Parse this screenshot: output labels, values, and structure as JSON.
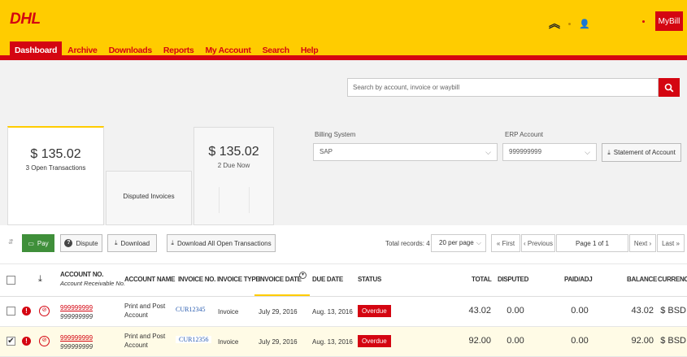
{
  "header": {
    "logo_text": "DHL",
    "mybill_label": "MyBill"
  },
  "nav": {
    "items": [
      "Dashboard",
      "Archive",
      "Downloads",
      "Reports",
      "My Account",
      "Search",
      "Help"
    ]
  },
  "search": {
    "placeholder": "Search by account, invoice or waybill"
  },
  "summary": {
    "open_amount": "$ 135.02",
    "open_label": "3 Open Transactions",
    "disputed_label": "Disputed Invoices",
    "due_amount": "$ 135.02",
    "due_label": "2 Due Now"
  },
  "filters": {
    "billing_label": "Billing System",
    "billing_value": "SAP",
    "erp_label": "ERP Account",
    "erp_value": "999999999",
    "statement_label": "Statement of Account"
  },
  "toolbar": {
    "pay": "Pay",
    "dispute": "Dispute",
    "download": "Download",
    "download_all": "Download All Open Transactions",
    "total_records": "Total records: 4",
    "per_page": "20 per page",
    "first": "« First",
    "previous": "‹ Previous",
    "page_info": "Page 1 of 1",
    "next": "Next ›",
    "last": "Last »"
  },
  "table": {
    "headers": {
      "account_no": "ACCOUNT NO.",
      "account_sub": "Account Receivable No.",
      "account_name": "ACCOUNT NAME",
      "invoice_no": "INVOICE NO.",
      "invoice_type": "INVOICE TYPE",
      "invoice_date": "INVOICE DATE",
      "due_date": "DUE DATE",
      "status": "STATUS",
      "total": "TOTAL",
      "disputed": "DISPUTED",
      "paid_adj": "PAID/ADJ",
      "balance": "BALANCE",
      "currency": "CURRENCY"
    },
    "rows": [
      {
        "account_no": "999999999",
        "ar_no": "999999999",
        "name_l1": "Print and Post",
        "name_l2": "Account",
        "invoice_no": "CUR12345",
        "type": "Invoice",
        "invoice_date": "July 29, 2016",
        "due_date": "Aug. 13, 2016",
        "status": "Overdue",
        "total": "43.02",
        "disputed": "0.00",
        "paid": "0.00",
        "balance": "43.02",
        "currency": "$ BSD",
        "selected": false
      },
      {
        "account_no": "999999999",
        "ar_no": "999999999",
        "name_l1": "Print and Post",
        "name_l2": "Account",
        "invoice_no": "CUR12356",
        "type": "Invoice",
        "invoice_date": "July 29, 2016",
        "due_date": "Aug. 13, 2016",
        "status": "Overdue",
        "total": "92.00",
        "disputed": "0.00",
        "paid": "0.00",
        "balance": "92.00",
        "currency": "$ BSD",
        "selected": true
      }
    ]
  },
  "colors": {
    "brand_yellow": "#ffcc00",
    "brand_red": "#d40511",
    "pay_green": "#3f8f3a"
  }
}
